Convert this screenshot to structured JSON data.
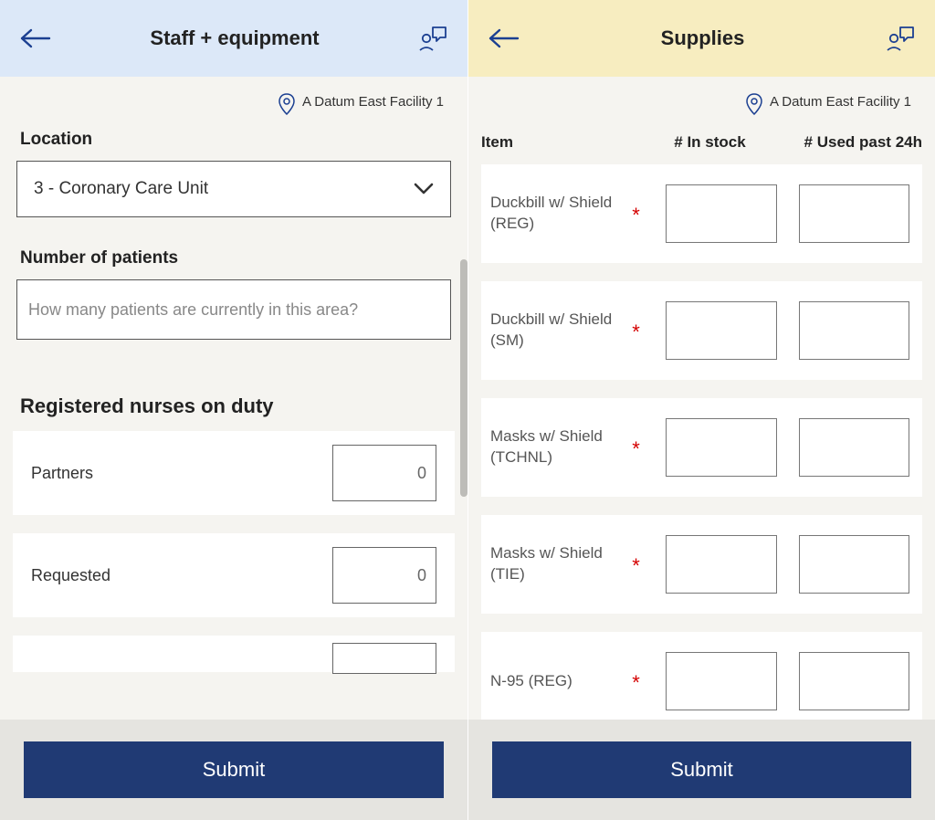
{
  "left": {
    "title": "Staff + equipment",
    "facility": "A Datum East Facility 1",
    "location_label": "Location",
    "location_value": "3 - Coronary Care Unit",
    "patients_label": "Number of patients",
    "patients_placeholder": "How many patients are currently in this area?",
    "group_heading": "Registered nurses on duty",
    "rows": [
      {
        "label": "Partners",
        "value": "0"
      },
      {
        "label": "Requested",
        "value": "0"
      }
    ],
    "submit": "Submit"
  },
  "right": {
    "title": "Supplies",
    "facility": "A Datum East Facility 1",
    "columns": {
      "item": "Item",
      "stock": "# In stock",
      "used": "# Used past 24h"
    },
    "items": [
      {
        "name": "Duckbill w/ Shield (REG)"
      },
      {
        "name": "Duckbill w/ Shield (SM)"
      },
      {
        "name": "Masks w/ Shield (TCHNL)"
      },
      {
        "name": "Masks w/ Shield (TIE)"
      },
      {
        "name": "N-95 (REG)"
      }
    ],
    "required_marker": "*",
    "submit": "Submit"
  },
  "colors": {
    "header_left": "#dce8f8",
    "header_right": "#f7edc0",
    "primary": "#203a74",
    "accent_icon": "#1b3f91"
  }
}
